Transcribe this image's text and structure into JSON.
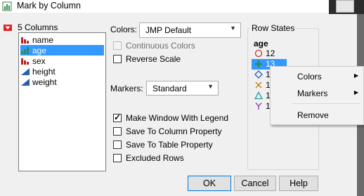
{
  "window": {
    "title": "Mark by Column"
  },
  "columns": {
    "header": "5 Columns",
    "items": [
      {
        "label": "name",
        "icon": "nominal-icon",
        "selected": false
      },
      {
        "label": "age",
        "icon": "ordinal-icon",
        "selected": true
      },
      {
        "label": "sex",
        "icon": "nominal-icon",
        "selected": false
      },
      {
        "label": "height",
        "icon": "continuous-icon",
        "selected": false
      },
      {
        "label": "weight",
        "icon": "continuous-icon",
        "selected": false
      }
    ]
  },
  "options": {
    "colors_label": "Colors:",
    "colors_value": "JMP Default",
    "continuous_colors": "Continuous Colors",
    "reverse_scale": "Reverse Scale",
    "markers_label": "Markers:",
    "markers_value": "Standard",
    "make_legend": "Make Window With Legend",
    "save_column_property": "Save To Column Property",
    "save_table_property": "Save To Table Property",
    "excluded_rows": "Excluded Rows"
  },
  "row_states": {
    "group_label": "Row States",
    "column_name": "age",
    "rows": [
      {
        "value": "12",
        "marker": "circle",
        "color": "#c0392b",
        "selected": false
      },
      {
        "value": "13",
        "marker": "plus",
        "color": "#2e8b57",
        "selected": true
      },
      {
        "value": "1",
        "marker": "diamond",
        "color": "#1f5fbf",
        "selected": false
      },
      {
        "value": "1",
        "marker": "x",
        "color": "#c87f1a",
        "selected": false
      },
      {
        "value": "1",
        "marker": "triangle",
        "color": "#1f9c9c",
        "selected": false
      },
      {
        "value": "1",
        "marker": "y",
        "color": "#8e44ad",
        "selected": false
      }
    ]
  },
  "context_menu": {
    "colors": "Colors",
    "markers": "Markers",
    "remove": "Remove"
  },
  "buttons": {
    "ok": "OK",
    "cancel": "Cancel",
    "help": "Help"
  }
}
